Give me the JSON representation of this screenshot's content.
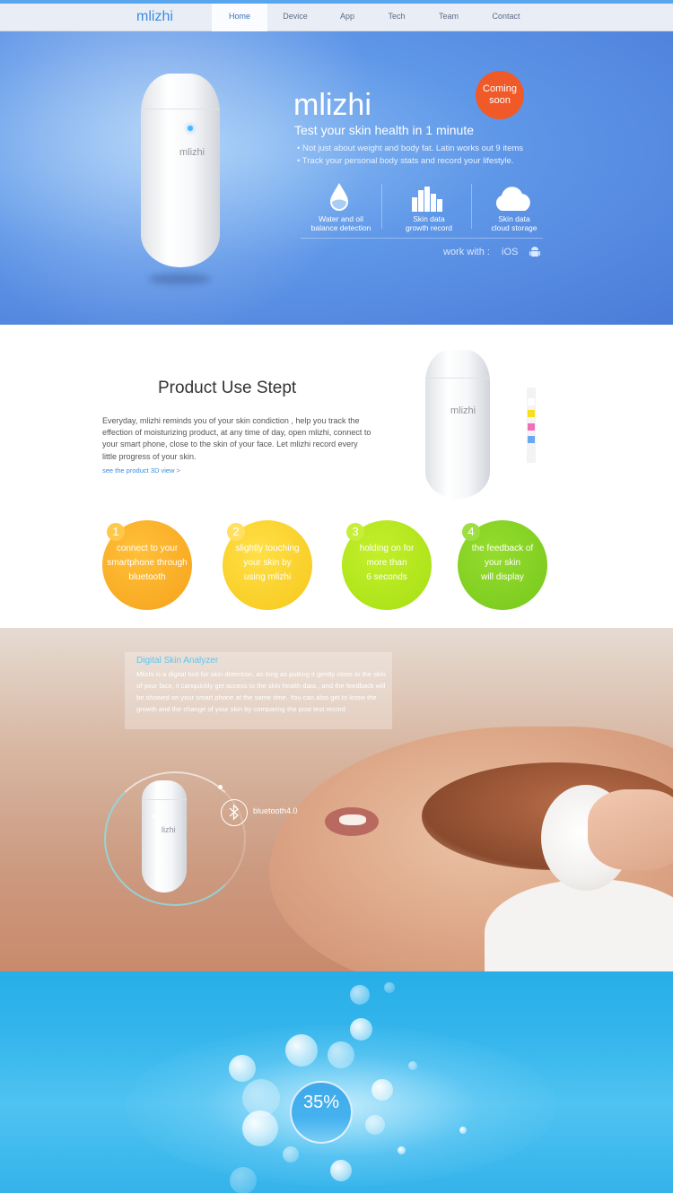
{
  "nav": {
    "logo": "mlizhi",
    "items": [
      "Home",
      "Device",
      "App",
      "Tech",
      "Team",
      "Contact"
    ],
    "active": "Home"
  },
  "hero": {
    "bottle_brand": "mlizhi",
    "title": "mlizhi",
    "subtitle": "Test your skin health in 1 minute",
    "badge": [
      "Coming",
      "soon"
    ],
    "bullets": [
      "• Not just about weight and body fat. Latin works out 9 items",
      "• Track your personal body stats and record your lifestyle."
    ],
    "features": [
      {
        "icon": "water-drop-icon",
        "label": [
          "Water and oil",
          "balance detection"
        ]
      },
      {
        "icon": "bar-chart-icon",
        "label": [
          "Skin data",
          "growth record"
        ]
      },
      {
        "icon": "cloud-icon",
        "label": [
          "Skin data",
          "cloud storage"
        ]
      }
    ],
    "work_with": "work with :",
    "ios": "iOS",
    "android_icon": "android-icon"
  },
  "product_use": {
    "title": "Product Use Stept",
    "body": "Everyday, mlizhi reminds you of your skin condiction , help you track the effection of moisturizing product, at any time of day, open mlizhi, connect to your smart phone, close to the skin of your face. Let mlizhi record every little progress of your skin.",
    "link": "see the product 3D view >",
    "bottle_brand": "mlizhi",
    "swatches": [
      "#ffffff",
      "#f7e01a",
      "#f16fb8",
      "#6aa8f2"
    ],
    "steps": [
      {
        "num": "1",
        "text": [
          "connect to your",
          "smartphone through",
          "bluetooth"
        ],
        "color": "#f7a21b"
      },
      {
        "num": "2",
        "text": [
          "slightly touching",
          "your skin by",
          "using mlizhi"
        ],
        "color": "#f7c71b"
      },
      {
        "num": "3",
        "text": [
          "holding on for",
          "more than",
          "6 seconds"
        ],
        "color": "#a6df14"
      },
      {
        "num": "4",
        "text": [
          "the feedback of",
          "your skin",
          "will display"
        ],
        "color": "#77c81e"
      }
    ]
  },
  "analyzer": {
    "title": "Digital Skin Analyzer",
    "body": "Mlizhi is a digital tool for skin detection, as long as putting it gently close to the skin of your face, it canquickly get access to the skin health data , and the feedback will be showed on your smart phone at the same time. You can also get to know the growth and the change of your skin by comparing the post test record",
    "bottle_brand": "lizhi",
    "bluetooth": "bluetooth4.0"
  },
  "meter": {
    "percent": "35%"
  }
}
